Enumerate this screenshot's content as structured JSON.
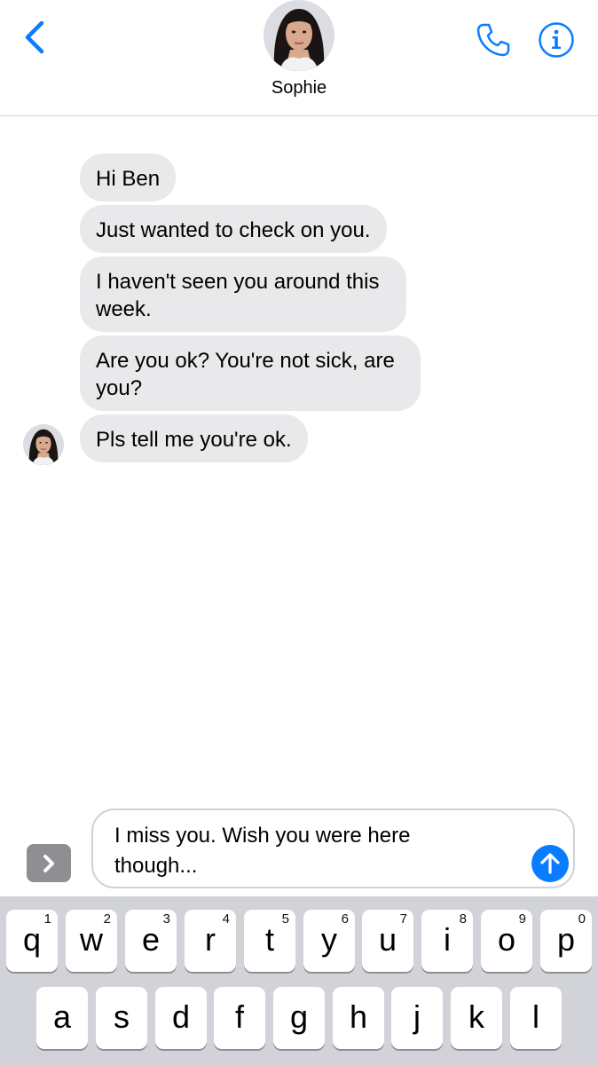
{
  "header": {
    "contact_name": "Sophie",
    "back_icon": "chevron-left-icon",
    "call_icon": "phone-icon",
    "info_icon": "info-icon"
  },
  "messages": [
    {
      "text": "Hi Ben"
    },
    {
      "text": "Just wanted to check on you."
    },
    {
      "text": "I haven't seen you around this week."
    },
    {
      "text": "Are you ok? You're not sick, are you?"
    },
    {
      "text": "Pls tell me you're ok."
    }
  ],
  "composer": {
    "value": "I miss you. Wish you were here though...",
    "apps_icon": "chevron-right-icon",
    "send_icon": "arrow-up-icon"
  },
  "keyboard": {
    "row1": [
      {
        "key": "q",
        "num": "1"
      },
      {
        "key": "w",
        "num": "2"
      },
      {
        "key": "e",
        "num": "3"
      },
      {
        "key": "r",
        "num": "4"
      },
      {
        "key": "t",
        "num": "5"
      },
      {
        "key": "y",
        "num": "6"
      },
      {
        "key": "u",
        "num": "7"
      },
      {
        "key": "i",
        "num": "8"
      },
      {
        "key": "o",
        "num": "9"
      },
      {
        "key": "p",
        "num": "0"
      }
    ],
    "row2": [
      {
        "key": "a"
      },
      {
        "key": "s"
      },
      {
        "key": "d"
      },
      {
        "key": "f"
      },
      {
        "key": "g"
      },
      {
        "key": "h"
      },
      {
        "key": "j"
      },
      {
        "key": "k"
      },
      {
        "key": "l"
      }
    ]
  },
  "colors": {
    "accent": "#0a7cff",
    "bubble_incoming": "#e9e9eb",
    "keyboard_bg": "#d1d3d9",
    "apps_button": "#8e8e93"
  }
}
